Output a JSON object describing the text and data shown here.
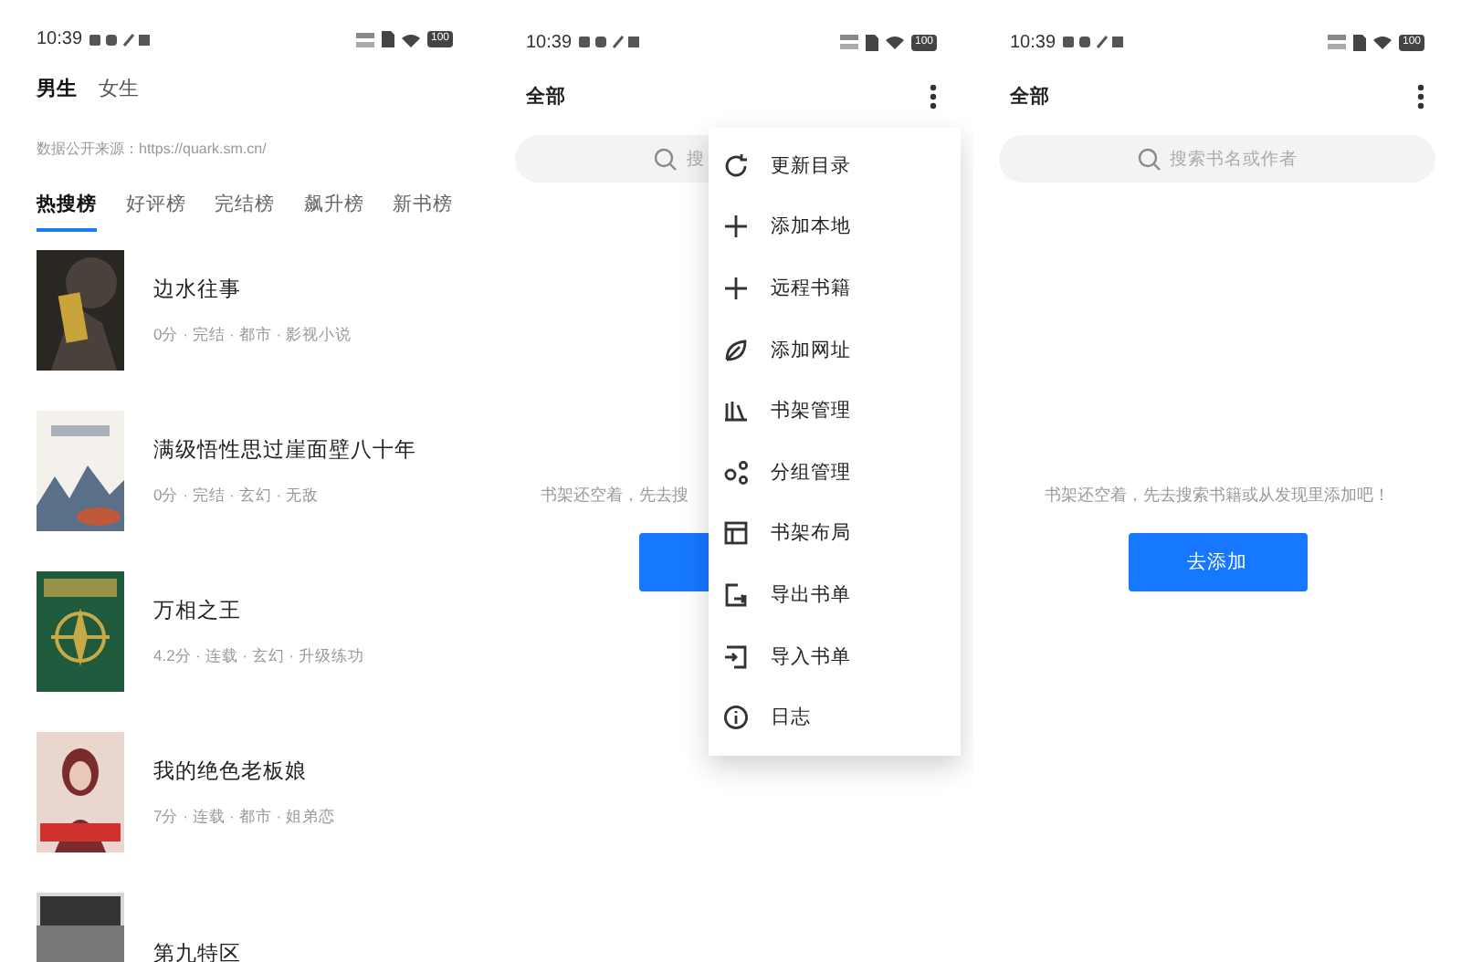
{
  "bookstore": {
    "status_bar": {
      "time": "10:39",
      "battery": "100"
    },
    "gender_tabs": [
      {
        "label": "男生",
        "selected": true
      },
      {
        "label": "女生",
        "selected": false
      }
    ],
    "source_note": "数据公开来源：https://quark.sm.cn/",
    "rank_tabs": [
      {
        "label": "热搜榜",
        "selected": true
      },
      {
        "label": "好评榜",
        "selected": false
      },
      {
        "label": "完结榜",
        "selected": false
      },
      {
        "label": "飙升榜",
        "selected": false
      },
      {
        "label": "新书榜",
        "selected": false
      }
    ],
    "books": [
      {
        "title": "边水往事",
        "meta": "0分 · 完结 · 都市 · 影视小说"
      },
      {
        "title": "满级悟性思过崖面壁八十年",
        "meta": "0分 · 完结 · 玄幻 · 无敌"
      },
      {
        "title": "万相之王",
        "meta": "4.2分 · 连载 · 玄幻 · 升级练功"
      },
      {
        "title": "我的绝色老板娘",
        "meta": "7分 · 连载 · 都市 · 姐弟恋"
      },
      {
        "title": "第九特区"
      }
    ]
  },
  "shelf_menu": {
    "status_bar": {
      "time": "10:39",
      "battery": "100"
    },
    "title": "全部",
    "search": {
      "placeholder": "搜"
    },
    "empty_text": "书架还空着，先去搜",
    "menu": [
      {
        "label": "更新目录"
      },
      {
        "label": "添加本地"
      },
      {
        "label": "远程书籍"
      },
      {
        "label": "添加网址"
      },
      {
        "label": "书架管理"
      },
      {
        "label": "分组管理"
      },
      {
        "label": "书架布局"
      },
      {
        "label": "导出书单"
      },
      {
        "label": "导入书单"
      },
      {
        "label": "日志"
      }
    ]
  },
  "shelf": {
    "status_bar": {
      "time": "10:39",
      "battery": "100"
    },
    "title": "全部",
    "search": {
      "placeholder": "搜索书名或作者"
    },
    "empty_text": "书架还空着，先去搜索书籍或从发现里添加吧！",
    "add_button": "去添加"
  }
}
